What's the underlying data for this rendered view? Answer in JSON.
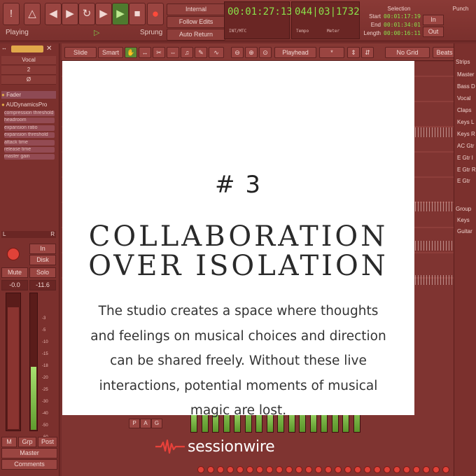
{
  "transport": {
    "icons": [
      "exclamation-icon",
      "metronome-icon",
      "go-start-icon",
      "go-end-icon",
      "loop-icon",
      "next-marker-icon",
      "play-icon",
      "stop-icon",
      "record-icon"
    ],
    "status_left": "Playing",
    "status_right": "Sprung",
    "sync": {
      "internal": "Internal",
      "follow_edits": "Follow Edits",
      "auto_return": "Auto Return"
    }
  },
  "clocks": {
    "primary": "00:01:27:13",
    "primary_sub": "INT/MTC",
    "secondary": "044|03|1732",
    "tempo_label": "Tempo",
    "meter_label": "Meter"
  },
  "selection": {
    "title": "Selection",
    "start_label": "Start",
    "start": "00:01:17:19",
    "end_label": "End",
    "end": "00:01:34:01",
    "length_label": "Length",
    "length": "00:00:16:11"
  },
  "punch": {
    "title": "Punch",
    "in": "In",
    "out": "Out"
  },
  "edit_toolbar": {
    "edit_mode": "Slide",
    "smart": "Smart",
    "edit_point": "Playhead",
    "grid": "No Grid",
    "grid_unit": "Beats"
  },
  "inspector": {
    "track_name": "Vocal",
    "channel": "2",
    "phase": "Ø",
    "plugin_fader": "Fader",
    "plugin_dyn": "AUDynamicsPro",
    "params": [
      "compression threshold",
      "headroom",
      "expansion ratio",
      "expansion threshold",
      "attack time",
      "release time",
      "master gain"
    ],
    "pan_left": "L",
    "pan_right": "R",
    "input": "In",
    "disk": "Disk",
    "mute": "Mute",
    "solo": "Solo",
    "gain": "-0.0",
    "peak": "-11.6",
    "scale": [
      "-3",
      "-5",
      "-10",
      "-15",
      "-18",
      "-20",
      "-25",
      "-30",
      "-40",
      "-50",
      "-60"
    ],
    "meter_level": 0.46,
    "meta": [
      "M",
      "Grp",
      "Post"
    ],
    "output": "Master",
    "comments": "Comments"
  },
  "strips_panel": {
    "title": "Strips",
    "items": [
      "Master",
      "Bass D",
      "Vocal",
      "Claps",
      "Keys L",
      "Keys R",
      "AC Gtr",
      "E Gtr l",
      "E Gtr R",
      "E Gtr"
    ],
    "group_title": "Group",
    "groups": [
      "Keys",
      "Guitar"
    ]
  },
  "mixer_tabs": [
    "P",
    "A",
    "G"
  ],
  "card": {
    "number": "# 3",
    "heading_line1": "COLLABORATION",
    "heading_line2": "OVER ISOLATION",
    "body": "The studio creates a space where thoughts and feelings on musical choices and direction can be shared freely. Without these live interactions, potential moments of musical magic are lost."
  },
  "brand": {
    "name": "sessionwire",
    "icon": "waveform-logo-icon",
    "color": "#e8413a"
  },
  "colors": {
    "background": "#722c2a",
    "card": "#ffffff",
    "meter_green": "#7fc24a",
    "record_red": "#e04238"
  }
}
